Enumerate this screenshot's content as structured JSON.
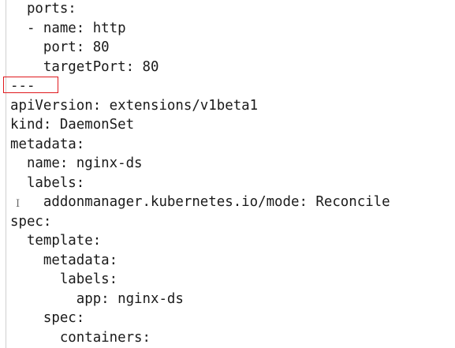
{
  "editor": {
    "lines": [
      "  ports:",
      "  - name: http",
      "    port: 80",
      "    targetPort: 80",
      "---",
      "apiVersion: extensions/v1beta1",
      "kind: DaemonSet",
      "metadata:",
      "  name: nginx-ds",
      "  labels:",
      "    addonmanager.kubernetes.io/mode: Reconcile",
      "spec:",
      "  template:",
      "    metadata:",
      "      labels:",
      "        app: nginx-ds",
      "    spec:",
      "      containers:"
    ],
    "highlight_color": "#e0191d",
    "cursor_icon": "text-cursor-icon"
  }
}
